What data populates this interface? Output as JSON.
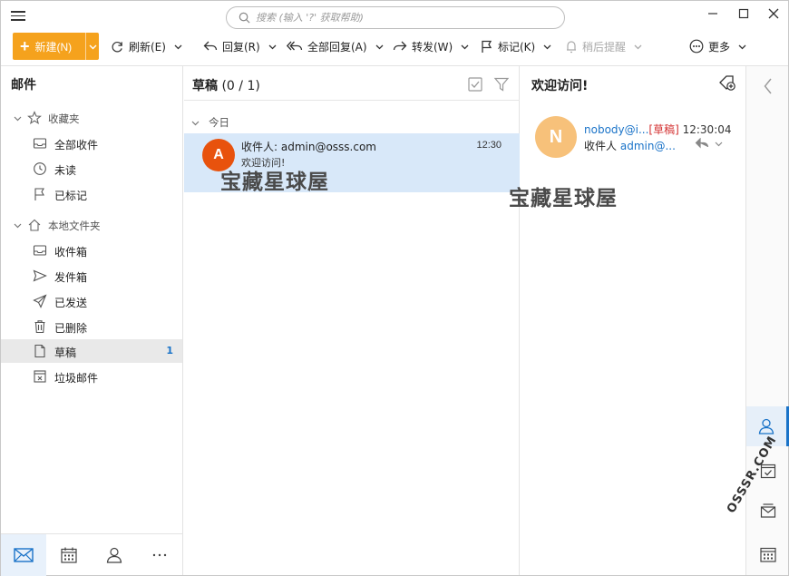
{
  "search": {
    "placeholder": "搜索 (输入 '?' 获取帮助)"
  },
  "toolbar": {
    "new_label": "新建(N)",
    "refresh_label": "刷新(E)",
    "reply_label": "回复(R)",
    "reply_all_label": "全部回复(A)",
    "forward_label": "转发(W)",
    "flag_label": "标记(K)",
    "remind_label": "稍后提醒",
    "more_label": "更多"
  },
  "sidebar": {
    "title": "邮件",
    "favorites_label": "收藏夹",
    "favorites": [
      {
        "label": "全部收件",
        "icon": "inbox-icon"
      },
      {
        "label": "未读",
        "icon": "clock-icon"
      },
      {
        "label": "已标记",
        "icon": "flag-icon"
      }
    ],
    "local_label": "本地文件夹",
    "local": [
      {
        "label": "收件箱",
        "icon": "inbox-icon"
      },
      {
        "label": "发件箱",
        "icon": "outbox-icon"
      },
      {
        "label": "已发送",
        "icon": "sent-icon"
      },
      {
        "label": "已删除",
        "icon": "trash-icon"
      },
      {
        "label": "草稿",
        "icon": "draft-icon",
        "count": "1"
      },
      {
        "label": "垃圾邮件",
        "icon": "junk-icon"
      }
    ]
  },
  "list": {
    "folder": "草稿",
    "count": "(0 / 1)",
    "group": "今日",
    "messages": [
      {
        "avatar": "A",
        "to": "收件人: admin@osss.com",
        "subject": "欢迎访问!",
        "time": "12:30"
      }
    ]
  },
  "reading": {
    "title": "欢迎访问!",
    "avatar": "N",
    "from": "nobody@i...",
    "draft_tag": "[草稿]",
    "time": "12:30:04",
    "to_label": "收件人",
    "to": "admin@..."
  },
  "watermarks": {
    "left": "宝藏星球屋",
    "right": "宝藏星球屋",
    "corner": "OSSSR.COM"
  },
  "colors": {
    "accent": "#f5a21d",
    "selection": "#d8e8f9",
    "link": "#1a73c8",
    "avatar_a": "#e8520d",
    "avatar_n": "#f7c17a"
  }
}
